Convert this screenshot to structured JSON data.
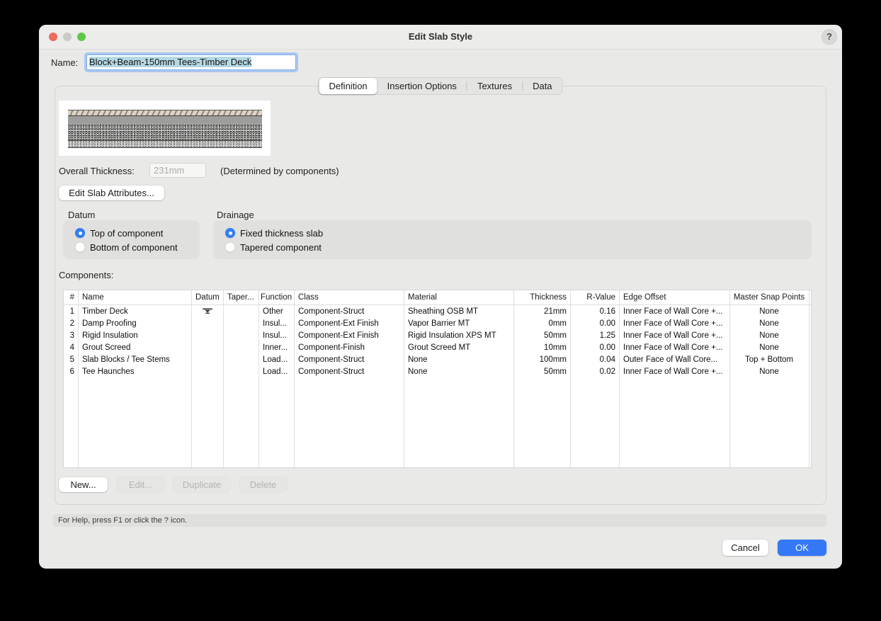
{
  "window": {
    "title": "Edit Slab Style",
    "help_button": "?"
  },
  "name_field": {
    "label": "Name:",
    "value": "Block+Beam-150mm Tees-Timber Deck"
  },
  "tabs": [
    {
      "label": "Definition",
      "selected": true
    },
    {
      "label": "Insertion Options",
      "selected": false
    },
    {
      "label": "Textures",
      "selected": false
    },
    {
      "label": "Data",
      "selected": false
    }
  ],
  "preview": {
    "layers": [
      "timber-deck-hatch",
      "solid-gray-band",
      "dark-stipple-band",
      "light-stipple-band"
    ]
  },
  "overall_thickness": {
    "label": "Overall Thickness:",
    "value": "231mm",
    "note": "(Determined by components)"
  },
  "edit_slab_attributes_button": "Edit Slab Attributes...",
  "datum_group": {
    "label": "Datum",
    "options": [
      {
        "label": "Top of component",
        "selected": true
      },
      {
        "label": "Bottom of component",
        "selected": false
      }
    ]
  },
  "drainage_group": {
    "label": "Drainage",
    "options": [
      {
        "label": "Fixed thickness slab",
        "selected": true
      },
      {
        "label": "Tapered component",
        "selected": false
      }
    ]
  },
  "components": {
    "label": "Components:",
    "columns": [
      "#",
      "Name",
      "Datum",
      "Taper...",
      "Function",
      "Class",
      "Material",
      "Thickness",
      "R-Value",
      "Edge Offset",
      "Master Snap Points"
    ],
    "rows": [
      {
        "num": "1",
        "name": "Timber Deck",
        "datum_icon": "datum-marker",
        "taper": "",
        "function": "Other",
        "class": "Component-Struct",
        "material": "Sheathing OSB MT",
        "thickness": "21mm",
        "r_value": "0.16",
        "edge_offset": "Inner Face of Wall Core +...",
        "snap": "None"
      },
      {
        "num": "2",
        "name": "Damp Proofing",
        "datum_icon": "",
        "taper": "",
        "function": "Insul...",
        "class": "Component-Ext Finish",
        "material": "Vapor Barrier MT",
        "thickness": "0mm",
        "r_value": "0.00",
        "edge_offset": "Inner Face of Wall Core +...",
        "snap": "None"
      },
      {
        "num": "3",
        "name": "Rigid Insulation",
        "datum_icon": "",
        "taper": "",
        "function": "Insul...",
        "class": "Component-Ext Finish",
        "material": "Rigid Insulation XPS MT",
        "thickness": "50mm",
        "r_value": "1.25",
        "edge_offset": "Inner Face of Wall Core +...",
        "snap": "None"
      },
      {
        "num": "4",
        "name": "Grout Screed",
        "datum_icon": "",
        "taper": "",
        "function": "Inner...",
        "class": "Component-Finish",
        "material": "Grout Screed MT",
        "thickness": "10mm",
        "r_value": "0.00",
        "edge_offset": "Inner Face of Wall Core +...",
        "snap": "None"
      },
      {
        "num": "5",
        "name": "Slab Blocks / Tee Stems",
        "datum_icon": "",
        "taper": "",
        "function": "Load...",
        "class": "Component-Struct",
        "material": "None",
        "thickness": "100mm",
        "r_value": "0.04",
        "edge_offset": "Outer Face of Wall Core...",
        "snap": "Top + Bottom"
      },
      {
        "num": "6",
        "name": "Tee Haunches",
        "datum_icon": "",
        "taper": "",
        "function": "Load...",
        "class": "Component-Struct",
        "material": "None",
        "thickness": "50mm",
        "r_value": "0.02",
        "edge_offset": "Inner Face of Wall Core +...",
        "snap": "None"
      }
    ]
  },
  "component_buttons": [
    {
      "label": "New...",
      "enabled": true
    },
    {
      "label": "Edit...",
      "enabled": false
    },
    {
      "label": "Duplicate",
      "enabled": false
    },
    {
      "label": "Delete",
      "enabled": false
    }
  ],
  "help_text": "For Help, press F1 or click the ? icon.",
  "footer": {
    "cancel": "Cancel",
    "ok": "OK"
  },
  "colors": {
    "accent_blue": "#3478f6",
    "selection_highlight": "#b5d9e4",
    "traffic_red": "#ed6a5e",
    "traffic_gray": "#c9c9c7",
    "traffic_green": "#5fc749",
    "dialog_background": "#e9e9e7"
  }
}
